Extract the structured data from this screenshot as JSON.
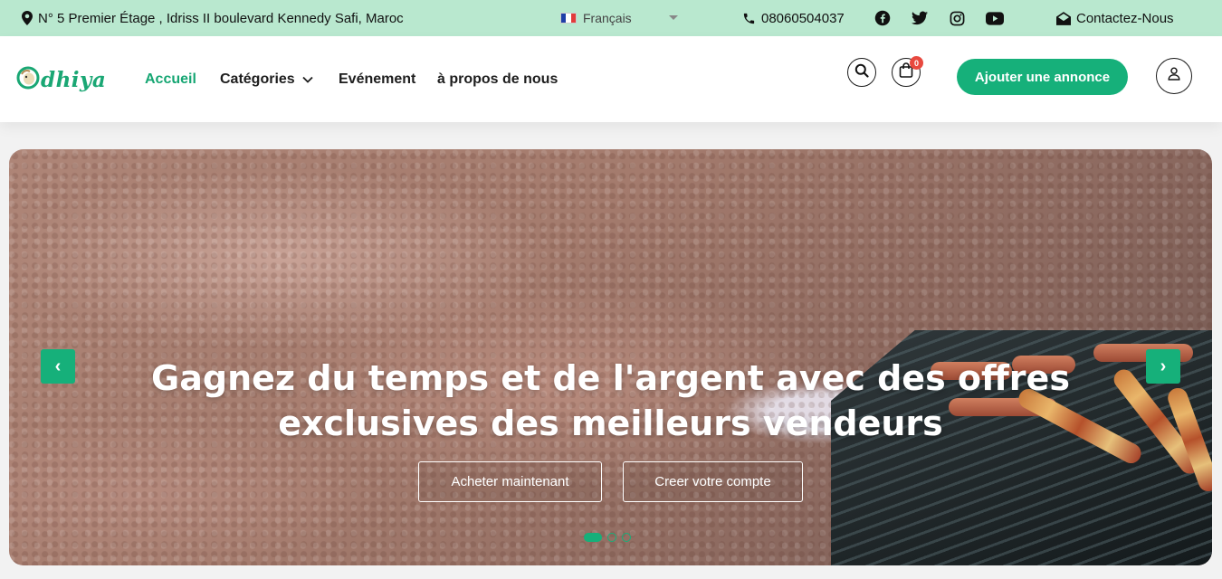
{
  "topbar": {
    "address": "N° 5 Premier Étage , Idriss II boulevard Kennedy Safi, Maroc",
    "language": "Français",
    "phone": "08060504037",
    "social": [
      "facebook-icon",
      "twitter-icon",
      "instagram-icon",
      "youtube-icon"
    ],
    "contact": "Contactez-Nous"
  },
  "header": {
    "logo_text": "dhiya",
    "nav": {
      "home": "Accueil",
      "categories": "Catégories",
      "event": "Evénement",
      "about": "à propos de nous"
    },
    "cart_count": "0",
    "add_listing": "Ajouter une annonce"
  },
  "hero": {
    "title_line1": "Gagnez du temps et de l'argent avec des offres",
    "title_line2": "exclusives des meilleurs vendeurs",
    "btn_buy": "Acheter maintenant",
    "btn_account": "Creer votre compte",
    "prev": "‹",
    "next": "›",
    "slide_count": 3,
    "active_slide": 1
  },
  "colors": {
    "accent": "#16b07a",
    "topbar_bg": "#b9e8cf",
    "badge": "#e8493f"
  }
}
